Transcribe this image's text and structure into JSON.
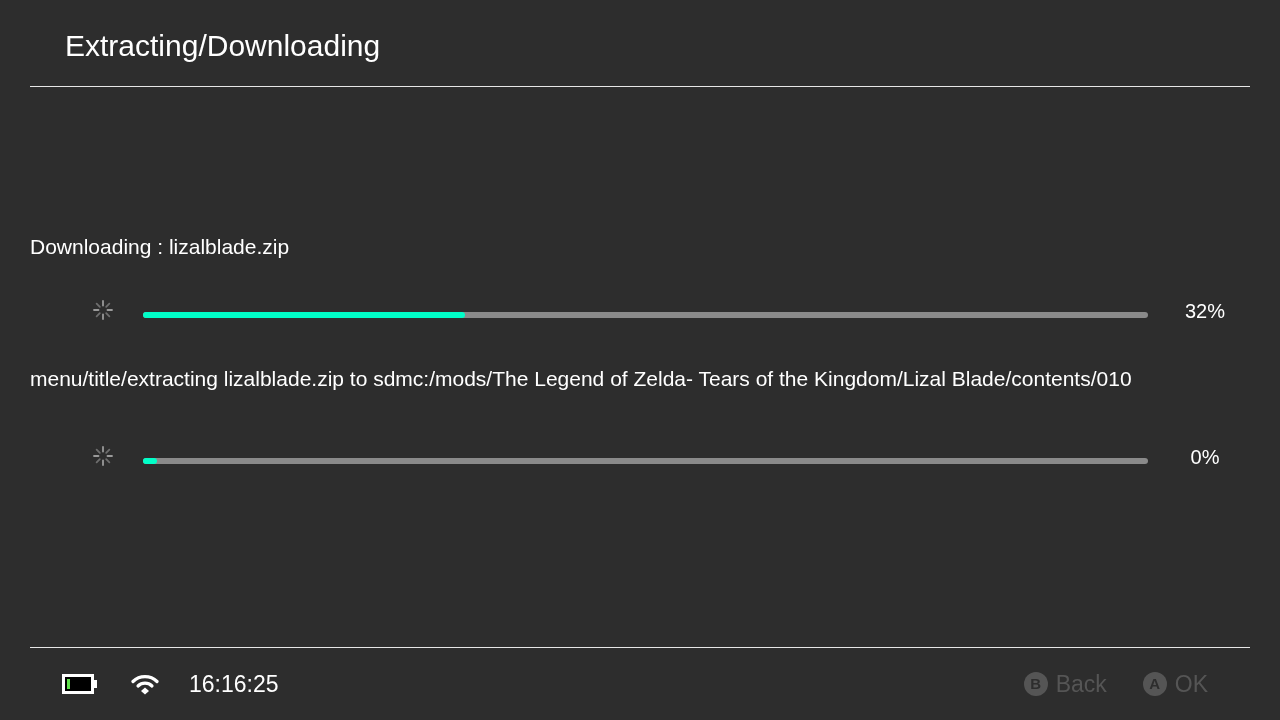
{
  "header": {
    "title": "Extracting/Downloading"
  },
  "tasks": [
    {
      "label": "Downloading : lizalblade.zip",
      "level": 0.32,
      "percent": "32%"
    },
    {
      "label": "menu/title/extracting lizalblade.zip to sdmc:/mods/The Legend of Zelda- Tears of the Kingdom/Lizal Blade/contents/010",
      "level": 0,
      "percent": "0%"
    }
  ],
  "status_bar": {
    "time": "16:16:25"
  },
  "buttons": [
    {
      "key": "B",
      "label": "Back",
      "disabled": true
    },
    {
      "key": "A",
      "label": "OK",
      "disabled": true
    }
  ]
}
